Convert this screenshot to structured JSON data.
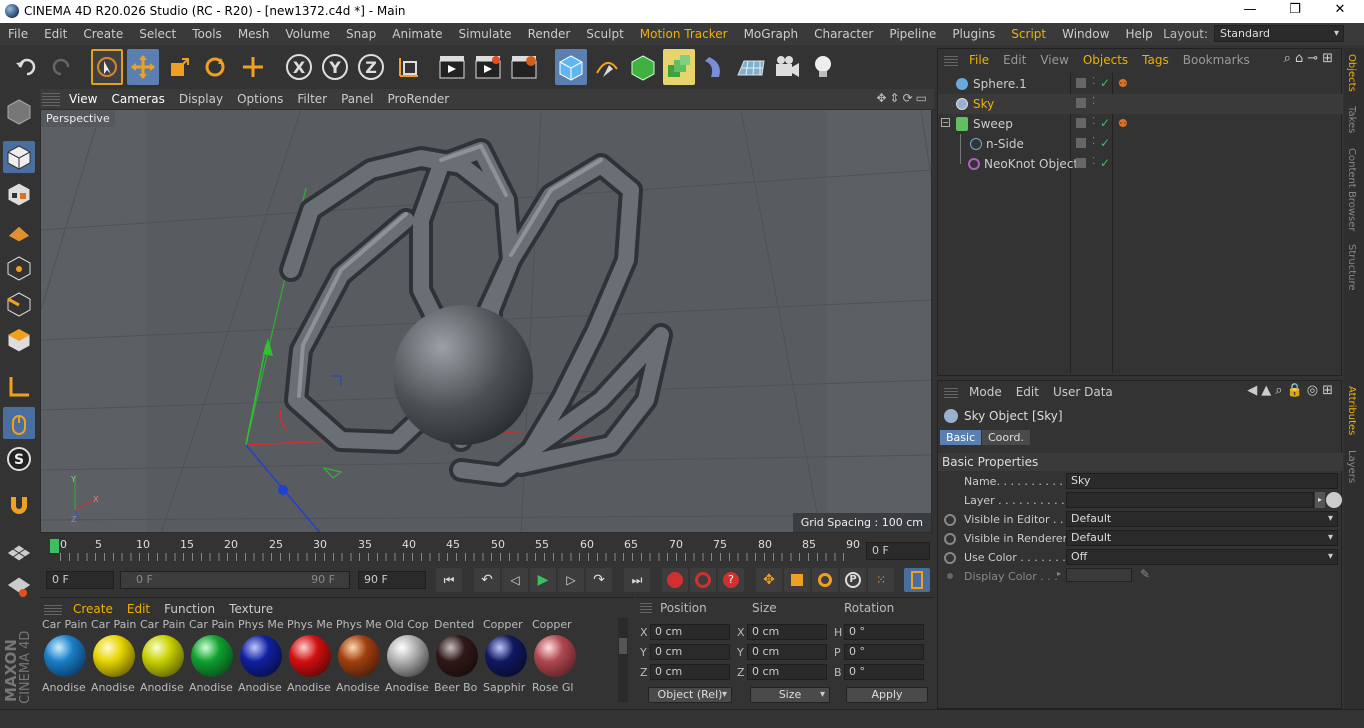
{
  "window": {
    "title": "CINEMA 4D R20.026 Studio (RC - R20) - [new1372.c4d *] - Main",
    "minimize": "—",
    "maximize": "❐",
    "close": "✕"
  },
  "menubar": {
    "items": [
      "File",
      "Edit",
      "Create",
      "Select",
      "Tools",
      "Mesh",
      "Volume",
      "Snap",
      "Animate",
      "Simulate",
      "Render",
      "Sculpt",
      "Motion Tracker",
      "MoGraph",
      "Character",
      "Pipeline",
      "Plugins",
      "Script",
      "Window",
      "Help"
    ],
    "highlighted": [
      "Motion Tracker",
      "Script"
    ],
    "layout_label": "Layout:",
    "layout_value": "Standard"
  },
  "viewport": {
    "menu": [
      "View",
      "Cameras",
      "Display",
      "Options",
      "Filter",
      "Panel",
      "ProRender"
    ],
    "camera_label": "Perspective",
    "grid_spacing": "Grid Spacing : 100 cm"
  },
  "timeline": {
    "ticks": [
      "0",
      "5",
      "10",
      "15",
      "20",
      "25",
      "30",
      "35",
      "40",
      "45",
      "50",
      "55",
      "60",
      "65",
      "70",
      "75",
      "80",
      "85",
      "90"
    ],
    "current_frame": "0 F",
    "start_field": "0 F",
    "range_start": "0 F",
    "range_end": "90 F",
    "end_field": "90 F"
  },
  "materials": {
    "menu": [
      "Create",
      "Edit",
      "Function",
      "Texture"
    ],
    "top_labels": [
      "Car Pain",
      "Car Pain",
      "Car Pain",
      "Car Pain",
      "Phys Me",
      "Phys Me",
      "Phys Me",
      "Old Cop",
      "Dented",
      "Copper",
      "Copper"
    ],
    "items": [
      {
        "label": "Anodise",
        "color": "#1a7fc8"
      },
      {
        "label": "Anodise",
        "color": "#e6d400"
      },
      {
        "label": "Anodise",
        "color": "#c8d000"
      },
      {
        "label": "Anodise",
        "color": "#10a030"
      },
      {
        "label": "Anodise",
        "color": "#1020a0"
      },
      {
        "label": "Anodise",
        "color": "#d01010"
      },
      {
        "label": "Anodise",
        "color": "#a04010"
      },
      {
        "label": "Anodise",
        "color": "#c8c8c8"
      },
      {
        "label": "Beer Bo",
        "color": "#301818"
      },
      {
        "label": "Sapphir",
        "color": "#101860"
      },
      {
        "label": "Rose Gl",
        "color": "#b04850"
      }
    ]
  },
  "coords": {
    "headers": [
      "Position",
      "Size",
      "Rotation"
    ],
    "rows": [
      {
        "axis": "X",
        "pos": "0 cm",
        "saxis": "X",
        "size": "0 cm",
        "raxis": "H",
        "rot": "0 °"
      },
      {
        "axis": "Y",
        "pos": "0 cm",
        "saxis": "Y",
        "size": "0 cm",
        "raxis": "P",
        "rot": "0 °"
      },
      {
        "axis": "Z",
        "pos": "0 cm",
        "saxis": "Z",
        "size": "0 cm",
        "raxis": "B",
        "rot": "0 °"
      }
    ],
    "mode": "Object (Rel)",
    "size_mode": "Size",
    "apply": "Apply"
  },
  "objects": {
    "menu": [
      "File",
      "Edit",
      "View",
      "Objects",
      "Tags",
      "Bookmarks"
    ],
    "highlighted": [
      "File",
      "Objects",
      "Tags"
    ],
    "rows": [
      {
        "name": "Sphere.1",
        "indent": 0,
        "color": "#ccc",
        "icon_color": "#6aa8e0"
      },
      {
        "name": "Sky",
        "indent": 0,
        "color": "#f0b000",
        "icon_color": "#9ab0d0"
      },
      {
        "name": "Sweep",
        "indent": 0,
        "color": "#ccc",
        "icon_color": "#60c060"
      },
      {
        "name": "n-Side",
        "indent": 1,
        "color": "#ccc",
        "icon_color": "#6aa8e0"
      },
      {
        "name": "NeoKnot Object",
        "indent": 1,
        "color": "#ccc",
        "icon_color": "#b060c0"
      }
    ]
  },
  "attributes": {
    "menu": [
      "Mode",
      "Edit",
      "User Data"
    ],
    "object_title": "Sky Object [Sky]",
    "tabs": [
      "Basic",
      "Coord."
    ],
    "section": "Basic Properties",
    "fields": [
      {
        "label": "Name. . . . . . . . . . . .",
        "value": "Sky"
      },
      {
        "label": "Layer . . . . . . . . . . . .",
        "value": ""
      },
      {
        "label": "Visible in Editor . .",
        "value": "Default"
      },
      {
        "label": "Visible in Renderer",
        "value": "Default"
      },
      {
        "label": "Use Color . . . . . . .",
        "value": "Off"
      },
      {
        "label": "Display Color . . .",
        "value": ""
      }
    ]
  },
  "sidetabs": {
    "items": [
      "Objects",
      "Takes",
      "Content Browser",
      "Structure",
      "Attributes",
      "Layers"
    ]
  },
  "branding": {
    "maxon": "MAXON",
    "cinema": "CINEMA 4D"
  }
}
